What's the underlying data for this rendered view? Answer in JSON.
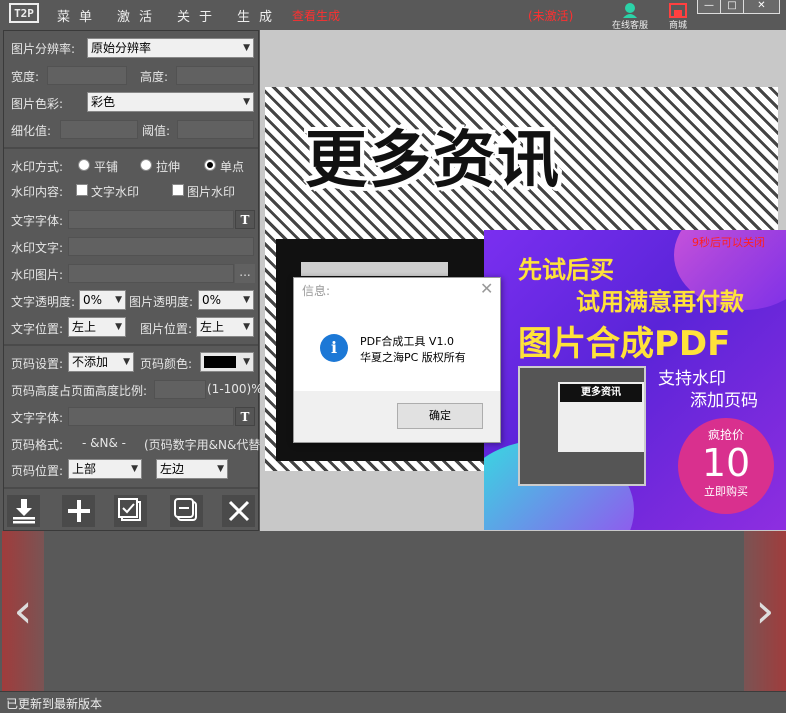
{
  "app": {
    "logo": "T2P",
    "menu": [
      "菜单",
      "激活",
      "关于",
      "生成"
    ],
    "unregistered_hint": "查看生成",
    "unregistered": "(未激活)",
    "service_label": "在线客服",
    "shop_label": "商城",
    "window_controls": [
      "—",
      "□",
      "✕"
    ]
  },
  "left": {
    "resolution_label": "图片分辨率:",
    "resolution_value": "原始分辨率",
    "width_label": "宽度:",
    "height_label": "高度:",
    "color_label": "图片色彩:",
    "color_value": "彩色",
    "detail_label": "细化值:",
    "threshold_label": "阈值:",
    "wm_mode_label": "水印方式:",
    "wm_modes": [
      "平铺",
      "拉伸",
      "单点"
    ],
    "wm_mode_selected": "单点",
    "wm_content_label": "水印内容:",
    "wm_content_opts": [
      "文字水印",
      "图片水印"
    ],
    "font_label": "文字字体:",
    "font_btn": "T",
    "wm_text_label": "水印文字:",
    "wm_image_label": "水印图片:",
    "browse": "...",
    "text_opacity_label": "文字透明度:",
    "text_opacity": "0%",
    "img_opacity_label": "图片透明度:",
    "img_opacity": "0%",
    "text_pos_label": "文字位置:",
    "text_pos": "左上",
    "img_pos_label": "图片位置:",
    "img_pos": "左上",
    "pageno_label": "页码设置:",
    "pageno_value": "不添加",
    "pageno_color_label": "页码颜色:",
    "pageno_ratio_label": "页码高度占页面高度比例:",
    "pageno_ratio_hint": "(1-100)%",
    "pageno_font_label": "文字字体:",
    "pageno_format_label": "页码格式:",
    "pageno_format": "- &N& -",
    "pageno_format_hint": "(页码数字用&N&代替)",
    "pageno_pos_label": "页码位置:",
    "pageno_pos_v": "上部",
    "pageno_pos_h": "左边"
  },
  "preview": {
    "headline": "更多资讯"
  },
  "ad": {
    "countdown": "9秒后可以关闭",
    "line1": "先试后买",
    "line2": "试用满意再付款",
    "line3": "图片合成PDF",
    "thumb_title": "更多资讯",
    "feature1": "支持水印",
    "feature2": "添加页码",
    "price_label": "疯抢价",
    "price": "10",
    "buy": "立即购买"
  },
  "dialog": {
    "caption": "信息:",
    "line1": "PDF合成工具 V1.0",
    "line2": "华夏之海PC 版权所有",
    "ok": "确定",
    "info_glyph": "i"
  },
  "status": {
    "text": "已更新到最新版本"
  },
  "colors": {
    "bg": "#595959",
    "accent_red": "#ff3030",
    "ad_purple": "#7a2ff0",
    "ad_yellow": "#ffe23a"
  }
}
